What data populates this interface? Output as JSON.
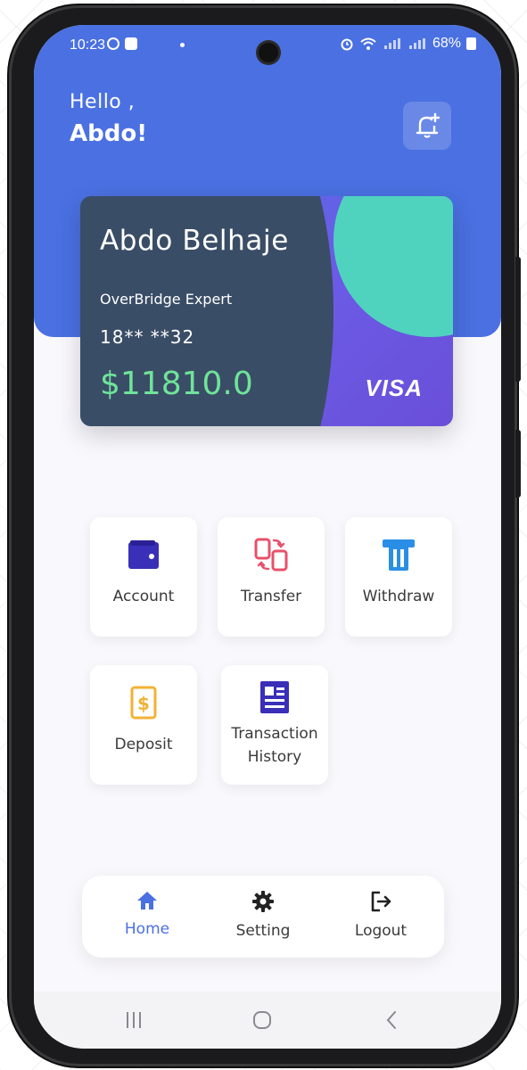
{
  "status_bar": {
    "time": "10:23",
    "battery_text": "68%"
  },
  "header": {
    "greeting": "Hello ,",
    "user_name": "Abdo!"
  },
  "card": {
    "holder_name": "Abdo Belhaje",
    "role": "OverBridge Expert",
    "masked_number": "18** **32",
    "balance": "$11810.0",
    "brand": "VISA"
  },
  "actions": [
    {
      "label": "Account",
      "icon": "wallet-icon",
      "color": "#3a2fb8"
    },
    {
      "label": "Transfer",
      "icon": "transfer-icon",
      "color": "#e8506b"
    },
    {
      "label": "Withdraw",
      "icon": "atm-withdraw-icon",
      "color": "#2b8ee6"
    },
    {
      "label": "Deposit",
      "icon": "dollar-deposit-icon",
      "color": "#f2b233"
    },
    {
      "label_line1": "Transaction",
      "label_line2": "History",
      "icon": "document-list-icon",
      "color": "#3a2fb8"
    }
  ],
  "bottom_nav": {
    "items": [
      {
        "label": "Home",
        "icon": "home-icon",
        "active": true
      },
      {
        "label": "Setting",
        "icon": "gear-icon",
        "active": false
      },
      {
        "label": "Logout",
        "icon": "logout-icon",
        "active": false
      }
    ]
  },
  "colors": {
    "primary": "#4a70e2",
    "card_dark": "#3a4d66",
    "card_teal": "#4fd3bf",
    "balance_green": "#6fe39a"
  }
}
